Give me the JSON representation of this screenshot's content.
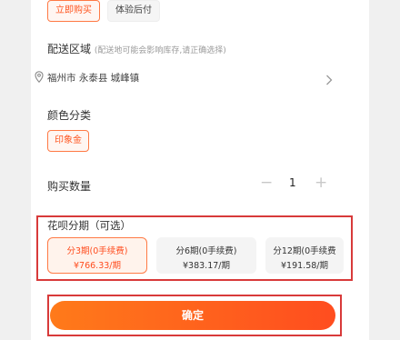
{
  "payment_options": {
    "buy_now": "立即购买",
    "pay_later": "体验后付"
  },
  "delivery": {
    "title": "配送区域",
    "hint": "(配送地可能会影响库存,请正确选择)",
    "address": "福州市 永泰县 城峰镇"
  },
  "color": {
    "title": "颜色分类",
    "selected": "印象金"
  },
  "quantity": {
    "title": "购买数量",
    "value": "1",
    "minus": "−",
    "plus": "+"
  },
  "huabei": {
    "title": "花呗分期（可选）",
    "plans": [
      {
        "term": "分3期(0手续费)",
        "amount": "¥766.33/期",
        "selected": true
      },
      {
        "term": "分6期(0手续费)",
        "amount": "¥383.17/期",
        "selected": false
      },
      {
        "term": "分12期(0手续费",
        "amount": "¥191.58/期",
        "selected": false
      }
    ]
  },
  "confirm_label": "确定",
  "colors": {
    "accent": "#ff5722",
    "highlight_box": "#d83a3a"
  }
}
